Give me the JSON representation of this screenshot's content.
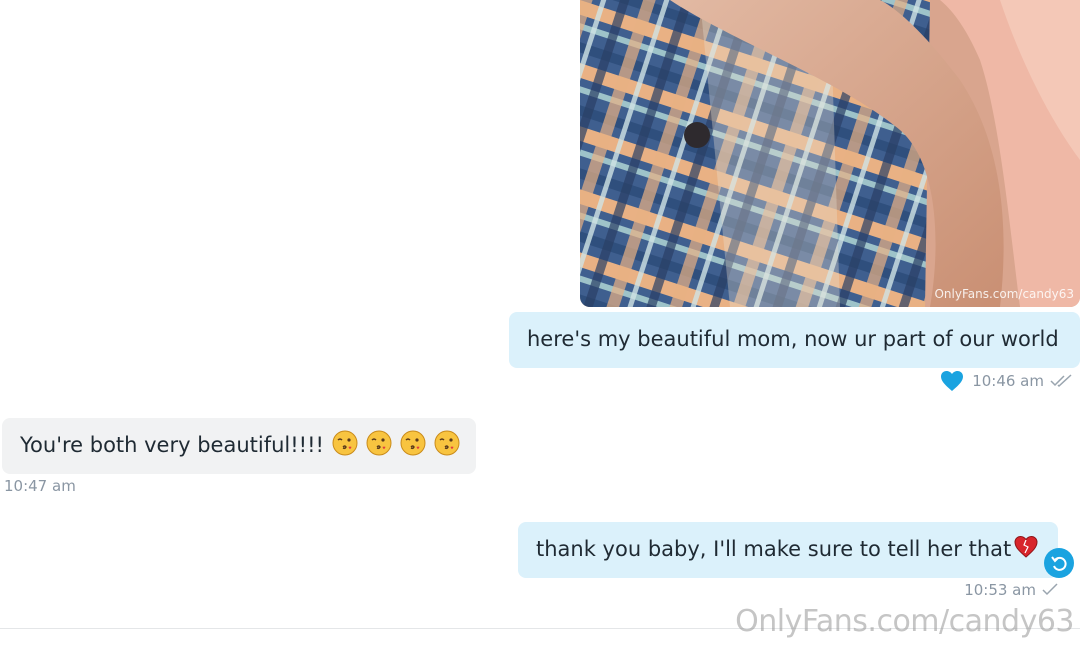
{
  "messages": [
    {
      "direction": "out",
      "kind": "image",
      "watermark": "OnlyFans.com/candy63"
    },
    {
      "direction": "out",
      "text": "here's my beautiful mom, now ur part of our world",
      "time": "10:46 am",
      "liked": true,
      "read_status": "double-check"
    },
    {
      "direction": "in",
      "text": "You're both very beautiful!!!!",
      "emojis": [
        "kissing-face-icon",
        "kissing-face-icon",
        "kissing-face-icon",
        "kissing-face-icon"
      ],
      "time": "10:47 am"
    },
    {
      "direction": "out",
      "text": "thank you baby, I'll make sure to tell her that",
      "trailing_emoji": "heart-icon",
      "time": "10:53 am",
      "read_status": "single-check"
    }
  ],
  "footer": {
    "watermark": "OnlyFans.com/candy63"
  },
  "colors": {
    "out_bubble": "#dbf1fb",
    "in_bubble": "#f1f2f3",
    "accent": "#1aa3e0",
    "meta_text": "#8a96a3"
  }
}
